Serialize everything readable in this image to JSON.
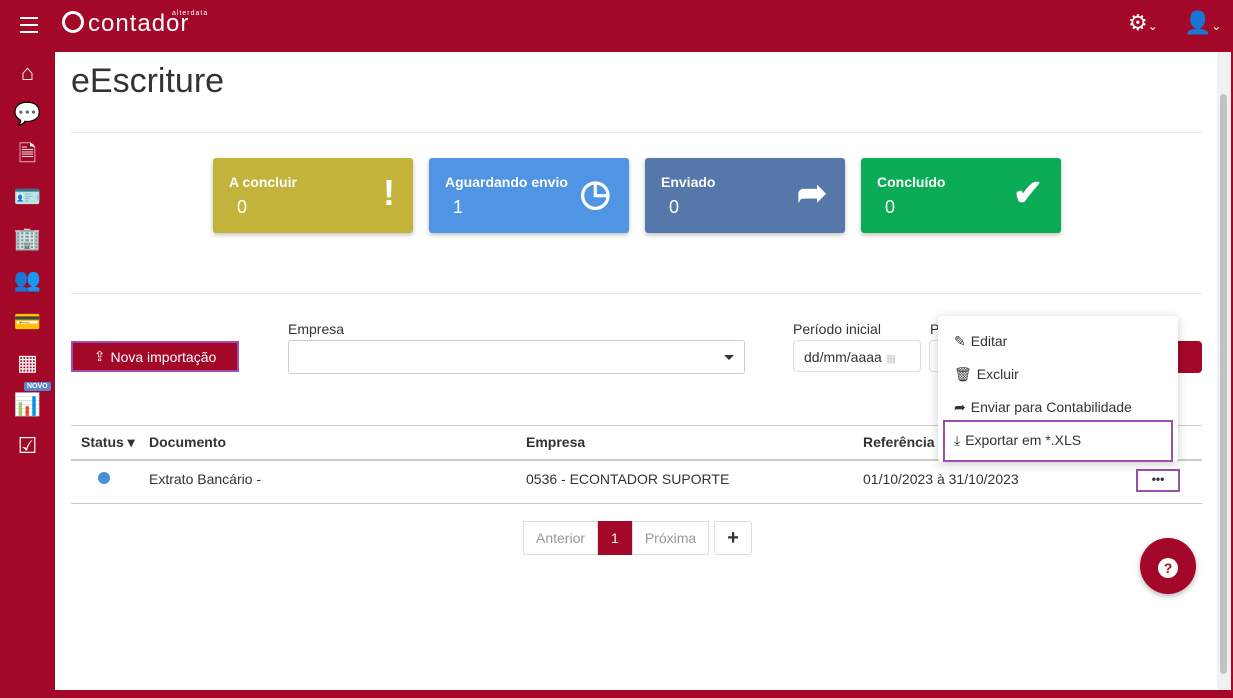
{
  "header": {
    "logo_text": "contador",
    "logo_sub": "alterdata"
  },
  "sidebar": {
    "novo_badge": "NOVO"
  },
  "page": {
    "title": "eEscriture"
  },
  "cards": [
    {
      "label": "A concluir",
      "value": "0",
      "color": "#c4b33a"
    },
    {
      "label": "Aguardando envio",
      "value": "1",
      "color": "#4f95e3"
    },
    {
      "label": "Enviado",
      "value": "0",
      "color": "#5577aa"
    },
    {
      "label": "Concluído",
      "value": "0",
      "color": "#0bac55"
    }
  ],
  "filters": {
    "new_import": "Nova importação",
    "empresa_label": "Empresa",
    "periodo_inicial_label": "Período inicial",
    "periodo_final_label": "P",
    "date_placeholder": "dd/mm/aaaa"
  },
  "table": {
    "headers": [
      "Status",
      "Documento",
      "Empresa",
      "Referência"
    ],
    "rows": [
      {
        "documento": "Extrato Bancário -",
        "empresa": "0536 - ECONTADOR SUPORTE",
        "referencia": "01/10/2023 à 31/10/2023",
        "actions": "•••"
      }
    ]
  },
  "pagination": {
    "prev": "Anterior",
    "current": "1",
    "next": "Próxima",
    "add": "+"
  },
  "menu": {
    "items": [
      "Editar",
      "Excluir",
      "Enviar para Contabilidade",
      "Exportar em *.XLS"
    ]
  }
}
